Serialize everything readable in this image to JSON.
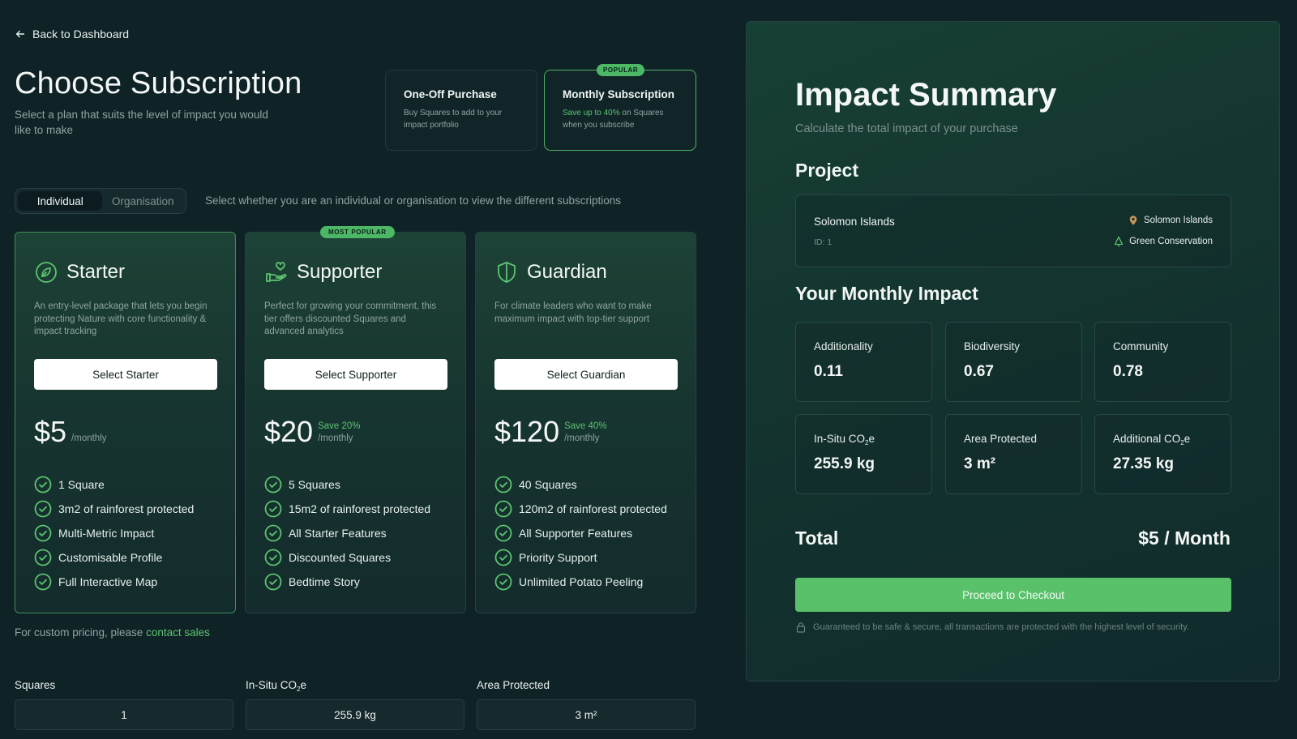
{
  "nav": {
    "back_label": "Back to Dashboard"
  },
  "header": {
    "title": "Choose Subscription",
    "subtitle": "Select a plan that suits the level of impact you would like to make"
  },
  "purchase_options": {
    "one_off": {
      "title": "One-Off Purchase",
      "desc": "Buy Squares to add to your impact portfolio"
    },
    "monthly": {
      "badge": "POPULAR",
      "title": "Monthly Subscription",
      "desc_highlight": "Save up to 40%",
      "desc_rest": " on Squares when you subscribe"
    }
  },
  "toggle": {
    "individual": "Individual",
    "organisation": "Organisation",
    "hint": "Select whether you are an individual or organisation to view the different subscriptions"
  },
  "plans": [
    {
      "name": "Starter",
      "icon": "leaf-icon",
      "desc": "An entry-level package that lets you begin protecting Nature with core functionality & impact tracking",
      "button": "Select Starter",
      "price": "$5",
      "save": "",
      "period": "/monthly",
      "features": [
        "1 Square",
        "3m2 of rainforest protected",
        "Multi-Metric Impact",
        "Customisable Profile",
        "Full Interactive Map"
      ]
    },
    {
      "name": "Supporter",
      "icon": "hand-heart-icon",
      "badge": "MOST POPULAR",
      "desc": "Perfect for growing your commitment, this tier offers discounted Squares and advanced analytics",
      "button": "Select Supporter",
      "price": "$20",
      "save": "Save 20%",
      "period": "/monthly",
      "features": [
        "5 Squares",
        "15m2 of rainforest protected",
        "All Starter Features",
        "Discounted Squares",
        "Bedtime Story"
      ]
    },
    {
      "name": "Guardian",
      "icon": "shield-icon",
      "desc": "For climate leaders who want to make maximum impact with top-tier support",
      "button": "Select Guardian",
      "price": "$120",
      "save": "Save 40%",
      "period": "/monthly",
      "features": [
        "40 Squares",
        "120m2 of rainforest protected",
        "All Supporter Features",
        "Priority Support",
        "Unlimited Potato Peeling"
      ]
    }
  ],
  "custom_pricing": {
    "text": "For custom pricing, please ",
    "link": "contact sales"
  },
  "stats": {
    "squares": {
      "label": "Squares",
      "value": "1"
    },
    "insitu": {
      "label_a": "In-Situ CO",
      "label_sub": "2",
      "label_b": "e",
      "value": "255.9 kg"
    },
    "area": {
      "label": "Area Protected",
      "value": "3 m²"
    }
  },
  "summary": {
    "title": "Impact Summary",
    "subtitle": "Calculate the total impact of your purchase",
    "project_heading": "Project",
    "project": {
      "name": "Solomon Islands",
      "id": "ID: 1",
      "location": "Solomon Islands",
      "category": "Green Conservation"
    },
    "monthly_heading": "Your Monthly Impact",
    "metrics": [
      {
        "label": "Additionality",
        "value": "0.11"
      },
      {
        "label": "Biodiversity",
        "value": "0.67"
      },
      {
        "label": "Community",
        "value": "0.78"
      },
      {
        "label_a": "In-Situ CO",
        "label_sub": "2",
        "label_b": "e",
        "value": "255.9 kg"
      },
      {
        "label": "Area Protected",
        "value": "3 m²"
      },
      {
        "label_a": "Additional CO",
        "label_sub": "2",
        "label_b": "e",
        "value": "27.35 kg"
      }
    ],
    "total_label": "Total",
    "total_value": "$5 / Month",
    "checkout": "Proceed to Checkout",
    "secure_note": "Guaranteed to be safe & secure, all transactions are protected with the highest level of security."
  },
  "colors": {
    "background": "#0f2226",
    "accent": "#5cc470",
    "button_green": "#59c16a"
  }
}
